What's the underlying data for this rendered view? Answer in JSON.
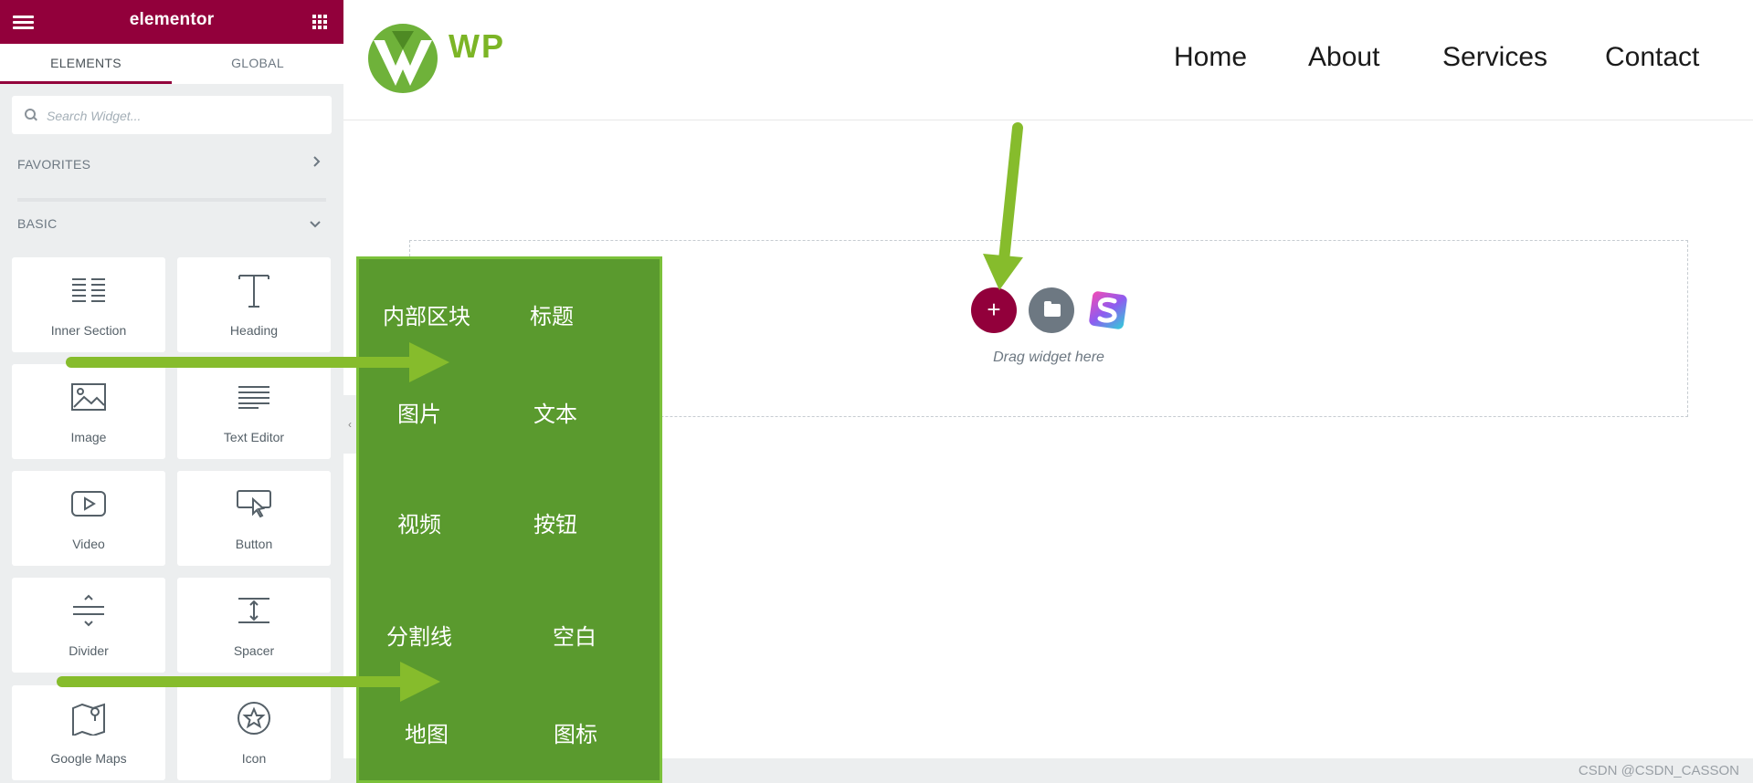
{
  "colors": {
    "brand": "#92003b",
    "overlay_green": "#5a9a2e",
    "arrow_green": "#86bc2c",
    "logo_green": "#7cb526"
  },
  "sidebar": {
    "brand": "elementor",
    "menu_icon": "hamburger-icon",
    "apps_icon": "grid-icon",
    "tabs": [
      {
        "label": "ELEMENTS"
      },
      {
        "label": "GLOBAL"
      }
    ],
    "search": {
      "placeholder": "Search Widget..."
    },
    "categories": [
      {
        "label": "FAVORITES",
        "icon": "chevron-right-icon"
      },
      {
        "label": "BASIC",
        "icon": "chevron-down-icon"
      }
    ],
    "widgets": [
      {
        "label": "Inner Section",
        "icon": "inner-section-icon"
      },
      {
        "label": "Heading",
        "icon": "heading-icon"
      },
      {
        "label": "Image",
        "icon": "image-icon"
      },
      {
        "label": "Text Editor",
        "icon": "text-editor-icon"
      },
      {
        "label": "Video",
        "icon": "video-icon"
      },
      {
        "label": "Button",
        "icon": "button-icon"
      },
      {
        "label": "Divider",
        "icon": "divider-icon"
      },
      {
        "label": "Spacer",
        "icon": "spacer-icon"
      },
      {
        "label": "Google Maps",
        "icon": "google-maps-icon"
      },
      {
        "label": "Icon",
        "icon": "star-icon"
      }
    ]
  },
  "site": {
    "logo_text": "WP",
    "nav": [
      {
        "label": "Home"
      },
      {
        "label": "About"
      },
      {
        "label": "Services"
      },
      {
        "label": "Contact"
      }
    ]
  },
  "canvas": {
    "add_label": "+",
    "drag_hint": "Drag widget here"
  },
  "annotations": {
    "labels": [
      "内部区块",
      "标题",
      "图片",
      "文本",
      "视频",
      "按钮",
      "分割线",
      "空白",
      "地图",
      "图标"
    ]
  },
  "watermark": "CSDN @CSDN_CASSON"
}
